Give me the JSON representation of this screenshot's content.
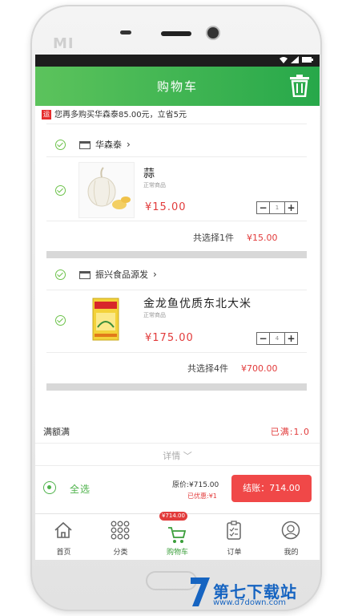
{
  "device": {
    "brand": "MI"
  },
  "header": {
    "title": "购物车"
  },
  "notice": {
    "badge": "运",
    "text": "您再多购买华森泰85.00元，立省5元"
  },
  "stores": [
    {
      "name": "华森泰",
      "product": {
        "name": "蒜",
        "tag": "正常商品",
        "price": "¥15.00",
        "qty": "1"
      },
      "subtotal": {
        "label": "共选择1件",
        "amount": "¥15.00"
      }
    },
    {
      "name": "振兴食品源发",
      "product": {
        "name": "金龙鱼优质东北大米",
        "tag": "正常商品",
        "price": "¥175.00",
        "qty": "4"
      },
      "subtotal": {
        "label": "共选择4件",
        "amount": "¥700.00"
      }
    }
  ],
  "stepper": {
    "minus": "−",
    "plus": "+"
  },
  "promo": {
    "label": "满额满",
    "status": "已满:1.0"
  },
  "details": {
    "label": "详情"
  },
  "footer": {
    "select_all": "全选",
    "original": "原价:¥715.00",
    "saved": "已优惠:¥1",
    "checkout": "结账：714.00"
  },
  "tabs": [
    {
      "label": "首页",
      "icon": "home-icon"
    },
    {
      "label": "分类",
      "icon": "grid-icon"
    },
    {
      "label": "购物车",
      "icon": "cart-icon",
      "badge": "¥714.00",
      "active": true
    },
    {
      "label": "订单",
      "icon": "clipboard-icon"
    },
    {
      "label": "我的",
      "icon": "user-icon"
    }
  ],
  "watermark": {
    "text": "第七下载站",
    "url": "www.d7down.com"
  },
  "colors": {
    "accent": "#2fae4a",
    "price": "#e23b3b",
    "checkout": "#f04848"
  }
}
